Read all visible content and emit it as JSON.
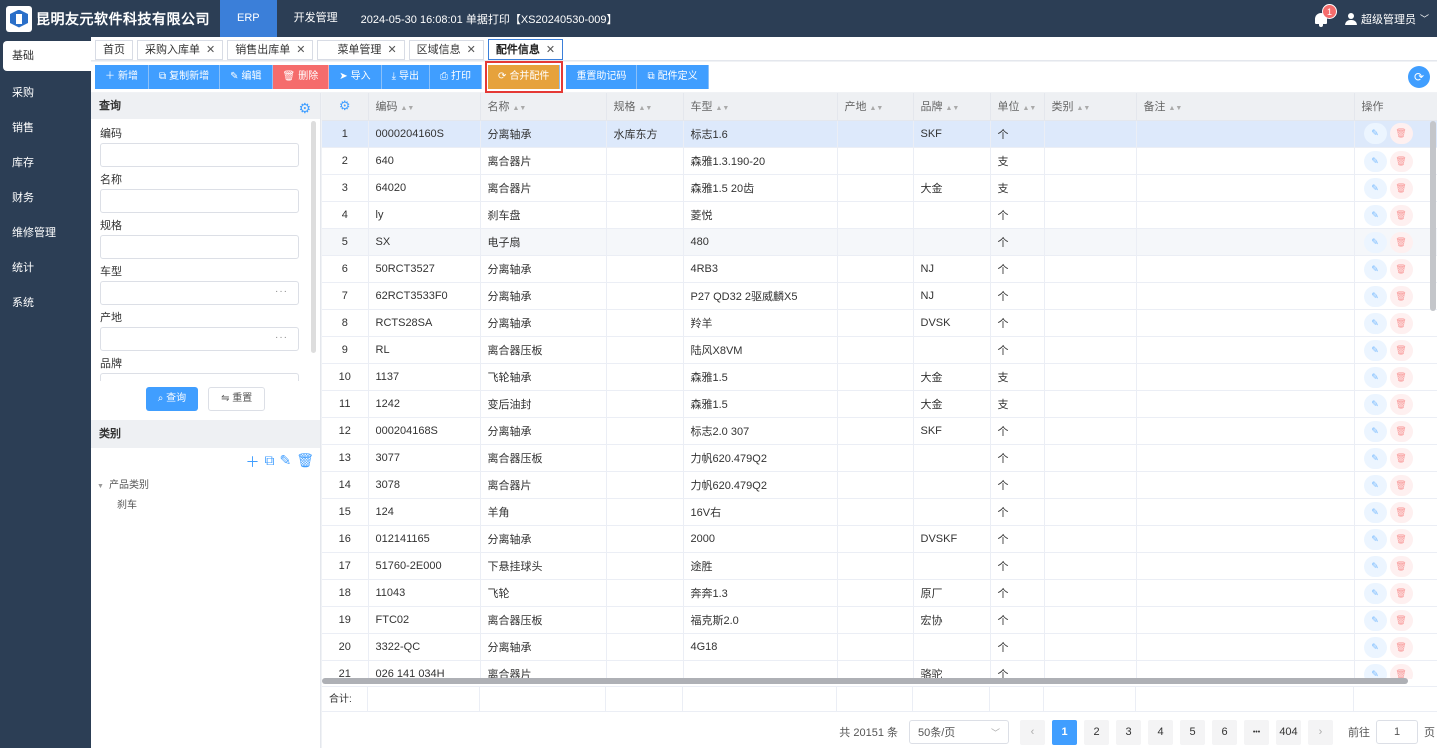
{
  "header": {
    "company": "昆明友元软件科技有限公司",
    "nav": [
      "ERP",
      "开发管理"
    ],
    "print_info": "2024-05-30 16:08:01 单据打印【XS20240530-009】",
    "notification_count": "1",
    "user": "超级管理员"
  },
  "sidebar": [
    "基础",
    "采购",
    "销售",
    "库存",
    "财务",
    "维修管理",
    "统计",
    "系统"
  ],
  "tabs": [
    "首页",
    "采购入库单",
    "销售出库单",
    "菜单管理",
    "区域信息",
    "配件信息"
  ],
  "toolbar": {
    "add": "新增",
    "copy_add": "复制新增",
    "edit": "编辑",
    "delete": "删除",
    "import": "导入",
    "export": "导出",
    "print": "打印",
    "merge": "合并配件",
    "reset_code": "重置助记码",
    "define": "配件定义"
  },
  "query": {
    "title": "查询",
    "fields": [
      "编码",
      "名称",
      "规格",
      "车型",
      "产地",
      "品牌"
    ],
    "search_btn": "查询",
    "reset_btn": "重置"
  },
  "category": {
    "title": "类别",
    "root": "产品类别",
    "child": "刹车"
  },
  "table": {
    "columns": [
      "编码",
      "名称",
      "规格",
      "车型",
      "产地",
      "品牌",
      "单位",
      "类别",
      "备注",
      "操作"
    ],
    "rows": [
      [
        "1",
        "0000204160S",
        "分离轴承",
        "水库东方",
        "标志1.6",
        "",
        "SKF",
        "个"
      ],
      [
        "2",
        "640",
        "离合器片",
        "",
        "森雅1.3.190-20",
        "",
        "",
        "支"
      ],
      [
        "3",
        "64020",
        "离合器片",
        "",
        "森雅1.5 20齿",
        "",
        "大金",
        "支"
      ],
      [
        "4",
        "ly",
        "刹车盘",
        "",
        "菱悦",
        "",
        "",
        "个"
      ],
      [
        "5",
        "SX",
        "电子扇",
        "",
        "480",
        "",
        "",
        "个"
      ],
      [
        "6",
        "50RCT3527",
        "分离轴承",
        "",
        "4RB3",
        "",
        "NJ",
        "个"
      ],
      [
        "7",
        "62RCT3533F0",
        "分离轴承",
        "",
        "P27 QD32 2驱威麟X5",
        "",
        "NJ",
        "个"
      ],
      [
        "8",
        "RCTS28SA",
        "分离轴承",
        "",
        "羚羊",
        "",
        "DVSK",
        "个"
      ],
      [
        "9",
        "RL",
        "离合器压板",
        "",
        "陆风X8VM",
        "",
        "",
        "个"
      ],
      [
        "10",
        "1137",
        "飞轮轴承",
        "",
        "森雅1.5",
        "",
        "大金",
        "支"
      ],
      [
        "11",
        "1242",
        "变后油封",
        "",
        "森雅1.5",
        "",
        "大金",
        "支"
      ],
      [
        "12",
        "000204168S",
        "分离轴承",
        "",
        "标志2.0 307",
        "",
        "SKF",
        "个"
      ],
      [
        "13",
        "3077",
        "离合器压板",
        "",
        "力帆620.479Q2",
        "",
        "",
        "个"
      ],
      [
        "14",
        "3078",
        "离合器片",
        "",
        "力帆620.479Q2",
        "",
        "",
        "个"
      ],
      [
        "15",
        "124",
        "羊角",
        "",
        "16V右",
        "",
        "",
        "个"
      ],
      [
        "16",
        "012141165",
        "分离轴承",
        "",
        "2000",
        "",
        "DVSKF",
        "个"
      ],
      [
        "17",
        "51760-2E000",
        "下悬挂球头",
        "",
        "途胜",
        "",
        "",
        "个"
      ],
      [
        "18",
        "11043",
        "飞轮",
        "",
        "奔奔1.3",
        "",
        "原厂",
        "个"
      ],
      [
        "19",
        "FTC02",
        "离合器压板",
        "",
        "福克斯2.0",
        "",
        "宏协",
        "个"
      ],
      [
        "20",
        "3322-QC",
        "分离轴承",
        "",
        "4G18",
        "",
        "",
        "个"
      ],
      [
        "21",
        "026 141 034H",
        "离合器片",
        "",
        "",
        "",
        "骆驼",
        "个"
      ]
    ],
    "sum_label": "合计:"
  },
  "pager": {
    "total": "共 20151 条",
    "page_size": "50条/页",
    "pages": [
      "1",
      "2",
      "3",
      "4",
      "5",
      "6",
      "404"
    ],
    "ellipsis": "•••",
    "goto_label": "前往",
    "goto_value": "1",
    "page_unit": "页"
  }
}
